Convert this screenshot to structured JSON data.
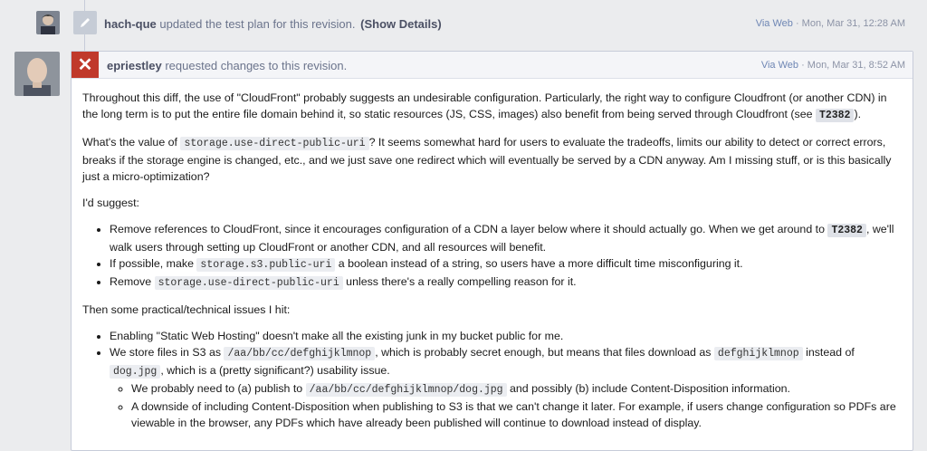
{
  "minor": {
    "actor": "hach-que",
    "action": "updated the test plan for this revision.",
    "details_link": "(Show Details)",
    "via": "Via Web",
    "time": "· Mon, Mar 31, 12:28 AM"
  },
  "comment": {
    "actor": "epriestley",
    "action": "requested changes to this revision.",
    "via": "Via Web",
    "time": "· Mon, Mar 31, 8:52 AM",
    "p1": {
      "a": "Throughout this diff, the use of \"CloudFront\" probably suggests an undesirable configuration. Particularly, the right way to configure Cloudfront (or another CDN) in the long term is to put the entire file domain behind it, so static resources (JS, CSS, images) also benefit from being served through Cloudfront (see ",
      "tag": "T2382",
      "b": ")."
    },
    "p2": {
      "a": "What's the value of ",
      "code": "storage.use-direct-public-uri",
      "b": "? It seems somewhat hard for users to evaluate the tradeoffs, limits our ability to detect or correct errors, breaks if the storage engine is changed, etc., and we just save one redirect which will eventually be served by a CDN anyway. Am I missing stuff, or is this basically just a micro-optimization?"
    },
    "p3": "I'd suggest:",
    "suggest": {
      "i1a": "Remove references to CloudFront, since it encourages configuration of a CDN a layer below where it should actually go. When we get around to ",
      "i1tag": "T2382",
      "i1b": ", we'll walk users through setting up CloudFront or another CDN, and all resources will benefit.",
      "i2a": "If possible, make ",
      "i2code": "storage.s3.public-uri",
      "i2b": " a boolean instead of a string, so users have a more difficult time misconfiguring it.",
      "i3a": "Remove ",
      "i3code": "storage.use-direct-public-uri",
      "i3b": " unless there's a really compelling reason for it."
    },
    "p4": "Then some practical/technical issues I hit:",
    "issues": {
      "i1": "Enabling \"Static Web Hosting\" doesn't make all the existing junk in my bucket public for me.",
      "i2a": "We store files in S3 as ",
      "i2code1": "/aa/bb/cc/defghijklmnop",
      "i2b": ", which is probably secret enough, but means that files download as ",
      "i2code2": "defghijklmnop",
      "i2c": " instead of ",
      "i2code3": "dog.jpg",
      "i2d": ", which is a (pretty significant?) usability issue.",
      "s1a": "We probably need to (a) publish to ",
      "s1code": "/aa/bb/cc/defghijklmnop/dog.jpg",
      "s1b": " and possibly (b) include Content-Disposition information.",
      "s2": "A downside of including Content-Disposition when publishing to S3 is that we can't change it later. For example, if users change configuration so PDFs are viewable in the browser, any PDFs which have already been published will continue to download instead of display."
    }
  }
}
